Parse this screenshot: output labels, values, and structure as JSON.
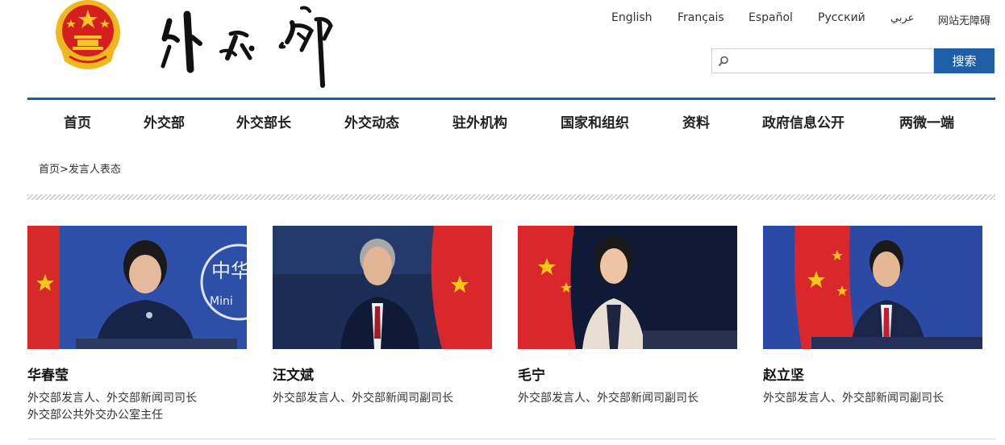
{
  "header": {
    "emblem_icon": "national-emblem-icon",
    "logo_icon": "ministry-calligraphy-logo",
    "languages": [
      "English",
      "Français",
      "Español",
      "Русский",
      "عربي",
      "网站无障碍"
    ],
    "search": {
      "placeholder": "",
      "button_label": "搜索",
      "icon": "search-icon"
    },
    "accent_color": "#17609f"
  },
  "nav": {
    "items": [
      "首页",
      "外交部",
      "外交部长",
      "外交动态",
      "驻外机构",
      "国家和组织",
      "资料",
      "政府信息公开",
      "两微一端"
    ]
  },
  "breadcrumb": {
    "home": "首页",
    "separator": ">",
    "current": "发言人表态"
  },
  "spokespersons": [
    {
      "name": "华春莹",
      "role_lines": [
        "外交部发言人、外交部新闻司司长",
        "外交部公共外交办公室主任"
      ],
      "photo_icon": "spokesperson-photo"
    },
    {
      "name": "汪文斌",
      "role_lines": [
        "外交部发言人、外交部新闻司副司长"
      ],
      "photo_icon": "spokesperson-photo"
    },
    {
      "name": "毛宁",
      "role_lines": [
        "外交部发言人、外交部新闻司副司长"
      ],
      "photo_icon": "spokesperson-photo"
    },
    {
      "name": "赵立坚",
      "role_lines": [
        "外交部发言人、外交部新闻司副司长"
      ],
      "photo_icon": "spokesperson-photo"
    }
  ]
}
